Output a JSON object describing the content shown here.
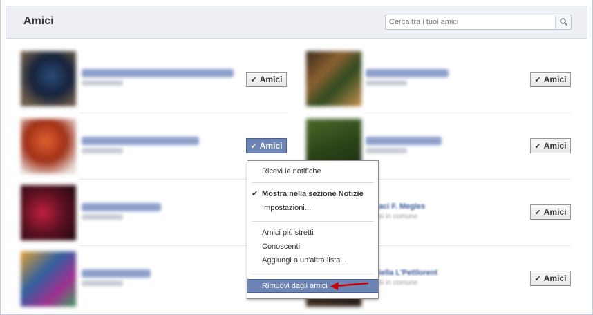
{
  "header": {
    "title": "Amici",
    "search_placeholder": "Cerca tra i tuoi amici"
  },
  "friends_button_label": "Amici",
  "friends_button_icon": "checkmark-icon",
  "menu": {
    "items": [
      "Ricevi le notifiche",
      "Mostra nella sezione Notizie",
      "Impostazioni...",
      "Amici più stretti",
      "Conoscenti",
      "Aggiungi a un'altra lista...",
      "Rimuovi dagli amici"
    ],
    "checked_item": "Mostra nella sezione Notizie",
    "highlighted_item": "Rimuovi dagli amici"
  },
  "partial_names": {
    "row3_right": "aci F. Megles",
    "row3_right_sub": "si in comune",
    "row4_right": "iella L'Pettlorent",
    "row4_right_sub": "si in comune"
  },
  "colors": {
    "accent": "#6d84b4",
    "header_bg": "#edeff4",
    "annotation_arrow": "#cc0000"
  }
}
